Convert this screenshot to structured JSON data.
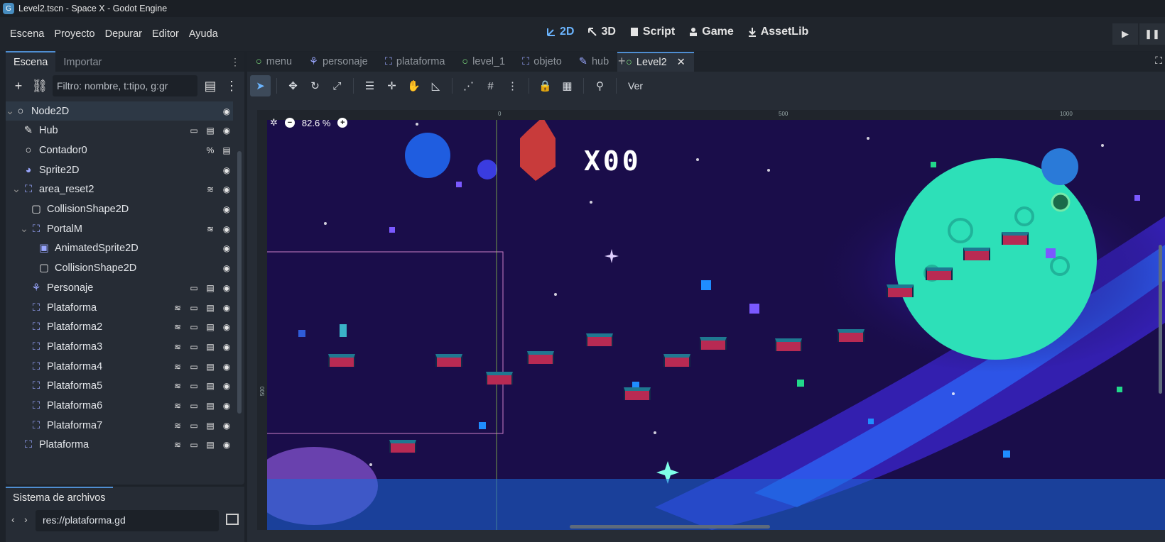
{
  "window": {
    "title": "Level2.tscn - Space X - Godot Engine"
  },
  "menu": [
    "Escena",
    "Proyecto",
    "Depurar",
    "Editor",
    "Ayuda"
  ],
  "workspaces": [
    "2D",
    "3D",
    "Script",
    "Game",
    "AssetLib"
  ],
  "scene_dock": {
    "tabs": [
      "Escena",
      "Importar"
    ],
    "filter_placeholder": "Filtro: nombre, t:tipo, g:gr",
    "nodes": [
      "Node2D",
      "Hub",
      "Contador0",
      "Sprite2D",
      "area_reset2",
      "CollisionShape2D",
      "PortalM",
      "AnimatedSprite2D",
      "CollisionShape2D",
      "Personaje",
      "Plataforma",
      "Plataforma2",
      "Plataforma3",
      "Plataforma4",
      "Plataforma5",
      "Plataforma6",
      "Plataforma7",
      "Plataforma"
    ]
  },
  "filesystem": {
    "tab": "Sistema de archivos",
    "path": "res://plataforma.gd"
  },
  "editor": {
    "scene_tabs": [
      "menu",
      "personaje",
      "plataforma",
      "level_1",
      "objeto",
      "hub",
      "Level2"
    ],
    "view_label": "Ver",
    "zoom": "82.6 %",
    "ruler": [
      "0",
      "500",
      "1000"
    ],
    "ruler_left": "500",
    "score_text": "X00"
  },
  "colors": {
    "accent": "#6bb5ff",
    "platform": "#b82a53",
    "planet": "#2de0b8",
    "space": "#1a0d4a"
  }
}
